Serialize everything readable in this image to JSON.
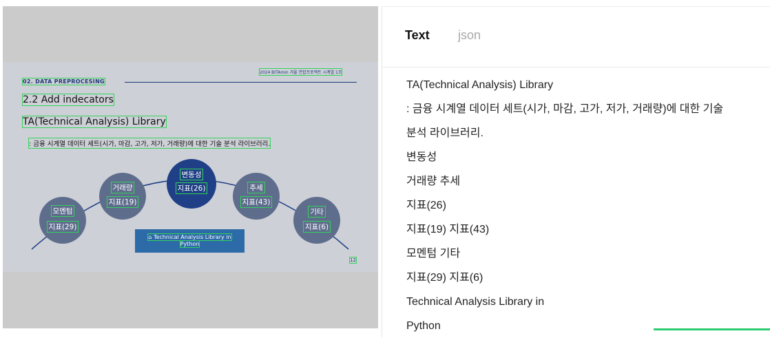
{
  "slide": {
    "header": "02. DATA PREPROCESING",
    "meta": "2024 BITAmin 겨울 연합프로젝트 시계열 1조",
    "title": "2.2 Add indecators",
    "subtitle": "TA(Technical Analysis) Library",
    "description": ": 금융 시계열 데이터 세트(시가, 마감, 고가, 저가, 거래량)에 대한 기술 분석 라이브러리.",
    "circles": {
      "momentum": {
        "name": "모멘텀",
        "count": "지표(29)"
      },
      "volume": {
        "name": "거래량",
        "count": "지표(19)"
      },
      "volatility": {
        "name": "변동성",
        "count": "지표(26)"
      },
      "trend": {
        "name": "추세",
        "count": "지표(43)"
      },
      "other": {
        "name": "기타",
        "count": "지표(6)"
      }
    },
    "callout": {
      "line1": "Technical Analysis Library in",
      "line2": "Python",
      "icon": "home-icon"
    },
    "page_number": "12"
  },
  "panel": {
    "tabs": {
      "text": "Text",
      "json": "json"
    },
    "lines": [
      "TA(Technical Analysis) Library",
      ": 금융 시계열 데이터 세트(시가, 마감, 고가, 저가, 거래량)에 대한 기술",
      "분석 라이브러리.",
      "변동성",
      "거래량 추세",
      "지표(26)",
      "지표(19) 지표(43)",
      "모멘텀 기타",
      "지표(29) 지표(6)",
      "Technical Analysis Library in",
      "Python"
    ]
  },
  "colors": {
    "highlight": "#32d35a",
    "navy": "#1f3f86",
    "slate": "#5f6d8d",
    "callout": "#2c6aa8",
    "accent": "#2ecc71"
  }
}
